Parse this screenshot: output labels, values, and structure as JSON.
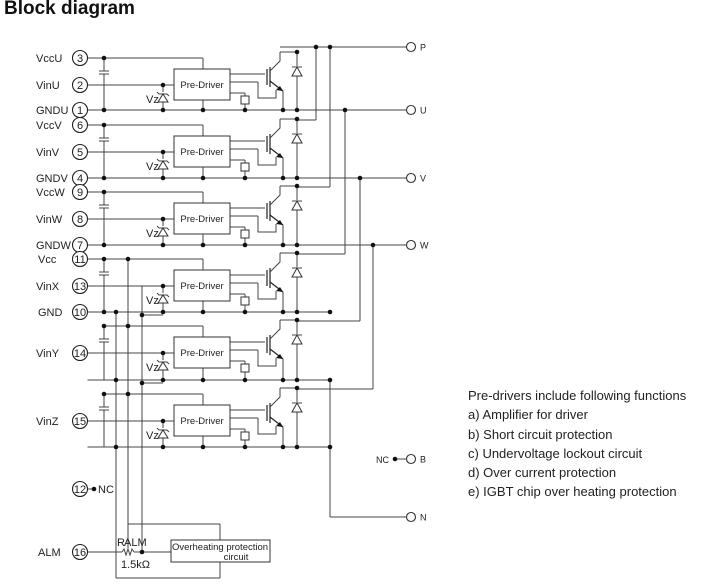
{
  "title": "Block diagram",
  "pins": [
    {
      "num": "3",
      "label": "VccU"
    },
    {
      "num": "2",
      "label": "VinU"
    },
    {
      "num": "1",
      "label": "GNDU"
    },
    {
      "num": "6",
      "label": "VccV"
    },
    {
      "num": "5",
      "label": "VinV"
    },
    {
      "num": "4",
      "label": "GNDV"
    },
    {
      "num": "9",
      "label": "VccW"
    },
    {
      "num": "8",
      "label": "VinW"
    },
    {
      "num": "7",
      "label": "GNDW"
    },
    {
      "num": "11",
      "label": "Vcc"
    },
    {
      "num": "13",
      "label": "VinX"
    },
    {
      "num": "10",
      "label": "GND"
    },
    {
      "num": "14",
      "label": "VinY"
    },
    {
      "num": "15",
      "label": "VinZ"
    },
    {
      "num": "12",
      "label": "NC"
    },
    {
      "num": "16",
      "label": "ALM"
    }
  ],
  "pre_driver_label": "Pre-Driver",
  "zener_label": "Vz",
  "outputs": {
    "P": "P",
    "U": "U",
    "V": "V",
    "W": "W",
    "B": "B",
    "N": "N",
    "nc_b": "NC"
  },
  "resistor": {
    "name": "RALM",
    "name_main": "R",
    "name_sub": "ALM",
    "value": "1.5kΩ"
  },
  "overheat_box": {
    "line1": "Overheating protection",
    "line2": "circuit"
  },
  "notes": {
    "heading": "Pre-drivers include following functions",
    "items": [
      "a) Amplifier for driver",
      "b) Short circuit protection",
      "c) Undervoltage lockout circuit",
      "d) Over current protection",
      "e) IGBT chip over heating protection"
    ]
  }
}
